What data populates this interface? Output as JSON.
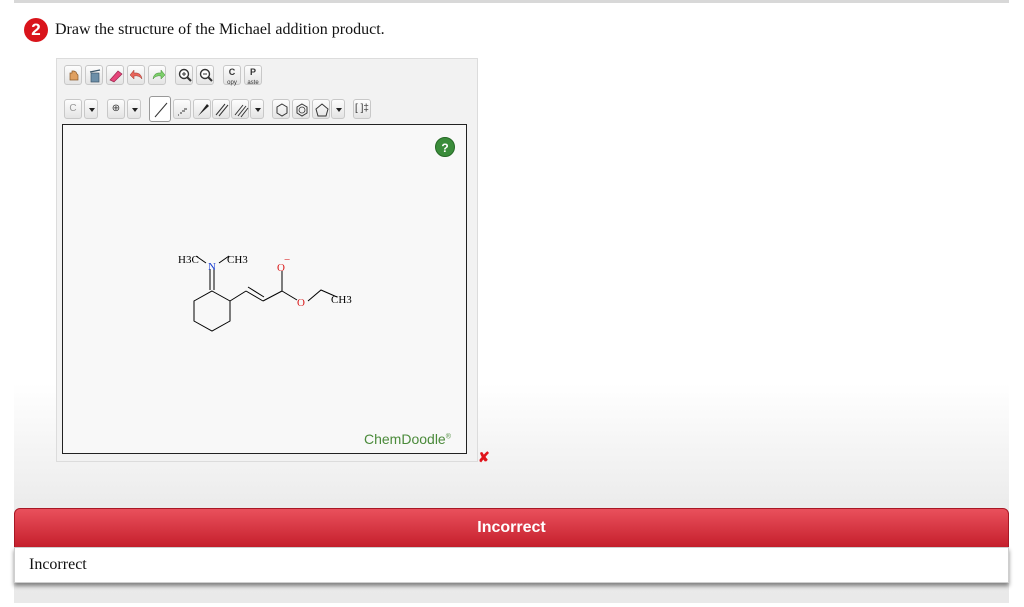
{
  "question": {
    "number": "2",
    "text": "Draw the structure of the Michael addition product."
  },
  "toolbar": {
    "copy_label": "C",
    "copy_sub": "opy",
    "paste_label": "P",
    "paste_sub": "aste",
    "element_label": "C",
    "charge_label": "⊕",
    "bracket_label": "[ ]‡"
  },
  "molecule": {
    "methyl1": "H3C",
    "nitrogen": "N",
    "methyl2": "CH3",
    "oxygen_minus": "O",
    "charge": "−",
    "ether_oxygen": "O",
    "methyl3": "CH3"
  },
  "canvas": {
    "help_label": "?",
    "brand": "ChemDoodle",
    "brand_mark": "®"
  },
  "feedback": {
    "result_mark": "✘",
    "header": "Incorrect",
    "body": "Incorrect"
  },
  "colors": {
    "badge": "#d9141b",
    "feedback_header": "#c51f2c",
    "nitrogen": "#1a3fd1",
    "oxygen": "#d91a1a",
    "brand": "#4a8a3a"
  }
}
